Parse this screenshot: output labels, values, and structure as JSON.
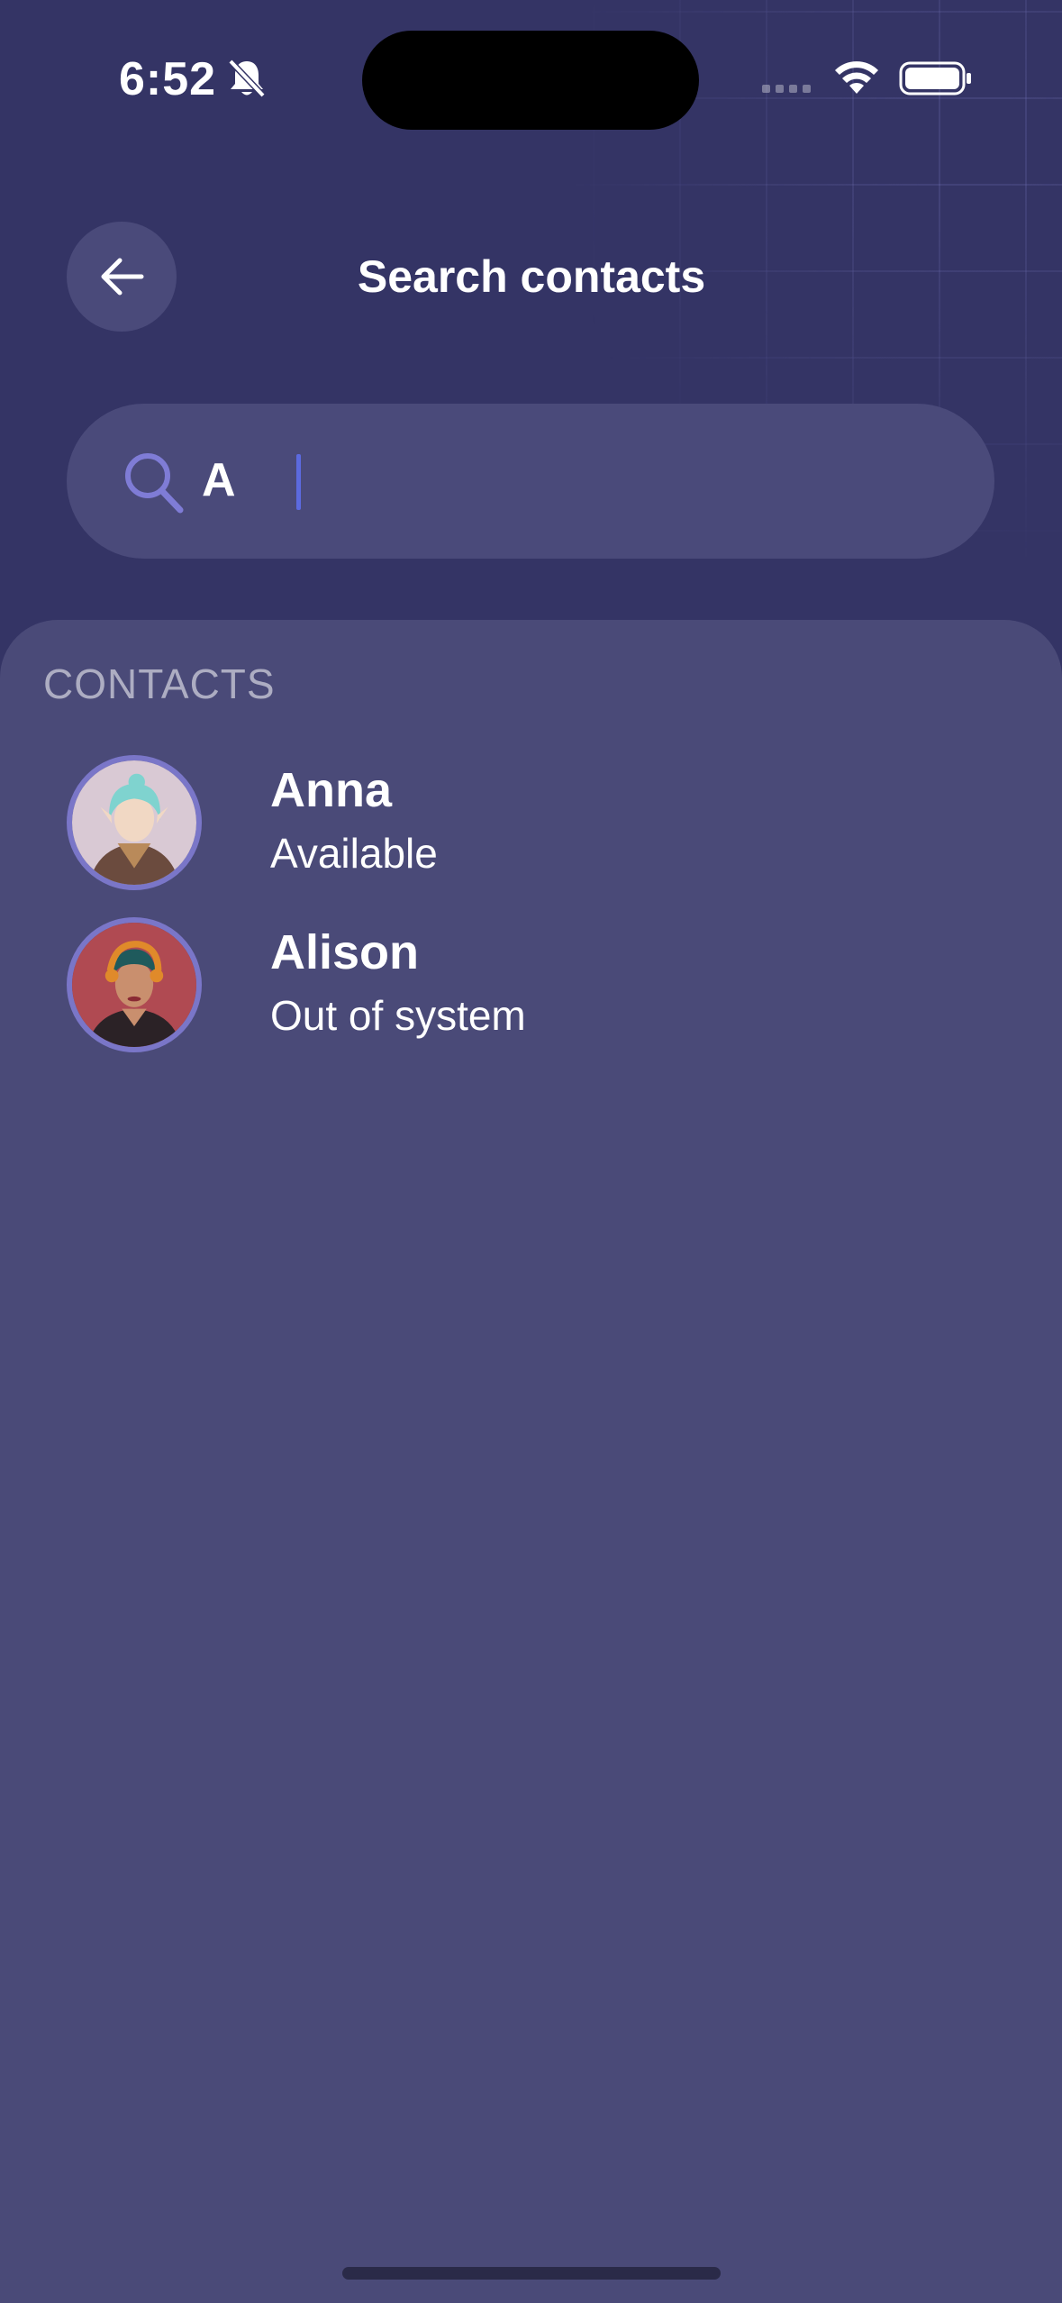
{
  "status_bar": {
    "time": "6:52",
    "icons": [
      "bell-muted-icon",
      "signal-icon",
      "wifi-icon",
      "battery-icon"
    ]
  },
  "header": {
    "title": "Search contacts",
    "back_icon": "arrow-left-icon"
  },
  "search": {
    "value": "A",
    "icon": "search-icon"
  },
  "contacts": {
    "section_label": "CONTACTS",
    "items": [
      {
        "name": "Anna",
        "status": "Available"
      },
      {
        "name": "Alison",
        "status": "Out of system"
      }
    ]
  },
  "colors": {
    "background": "#343465",
    "sheet": "#4a4a78",
    "field": "#4a4a7a",
    "accent": "#7a76c8",
    "caret": "#5c6ae0"
  }
}
